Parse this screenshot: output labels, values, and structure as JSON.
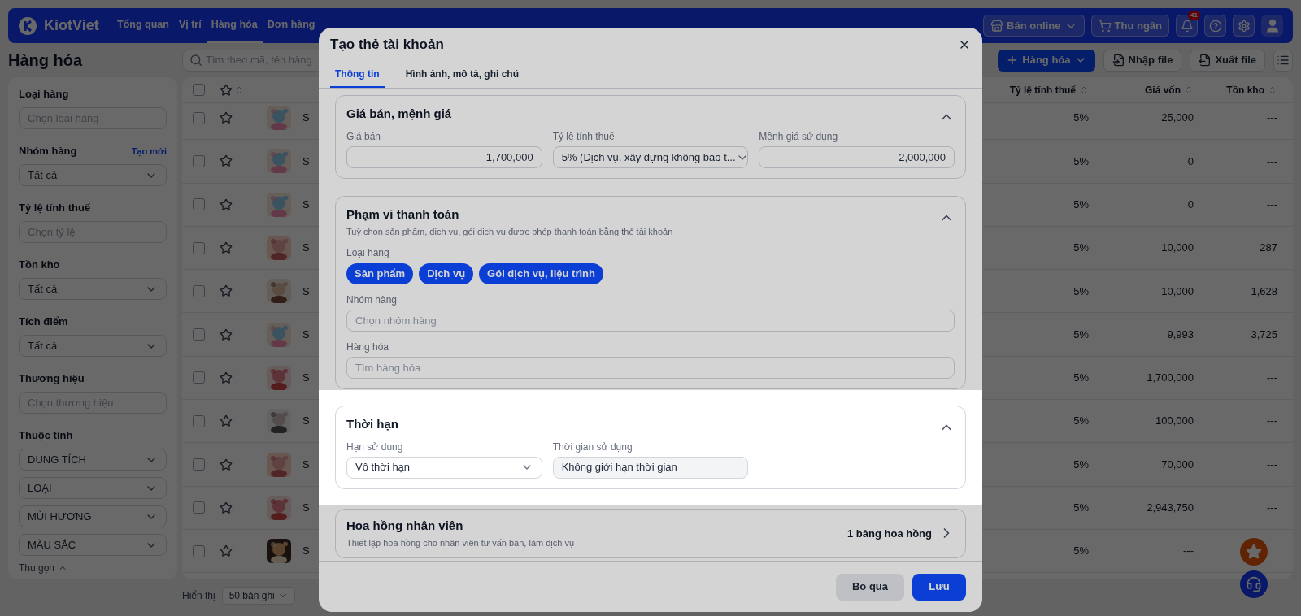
{
  "nav": {
    "logo": "KiotViet",
    "items": [
      {
        "label": "Tổng quan",
        "selected": false
      },
      {
        "label": "Vị trí",
        "selected": false
      },
      {
        "label": "Hàng hóa",
        "selected": true
      },
      {
        "label": "Đơn hàng",
        "selected": false
      }
    ],
    "online": "Bán online",
    "cashier": "Thu ngân",
    "notifications": "41"
  },
  "page": {
    "title": "Hàng hóa",
    "search_placeholder": "Tìm theo mã, tên hàng",
    "buttons": [
      {
        "label": "Hàng hóa",
        "kind": "create"
      },
      {
        "label": "Nhập file",
        "kind": "import"
      },
      {
        "label": "Xuất file",
        "kind": "export"
      }
    ]
  },
  "sidebar": {
    "filters": [
      {
        "label": "Loại hàng",
        "kind": "input",
        "placeholder": "Chọn loại hàng"
      },
      {
        "label": "Nhóm hàng",
        "kind": "select",
        "value": "Tất cả",
        "link": "Tạo mới"
      },
      {
        "label": "Tỷ lệ tính thuế",
        "kind": "input",
        "placeholder": "Chọn tỷ lệ"
      },
      {
        "label": "Tồn kho",
        "kind": "select",
        "value": "Tất cả"
      },
      {
        "label": "Tích điểm",
        "kind": "select",
        "value": "Tất cả"
      },
      {
        "label": "Thương hiệu",
        "kind": "input",
        "placeholder": "Chọn thương hiệu"
      },
      {
        "label": "Thuộc tính",
        "kind": "selects",
        "values": [
          "DUNG TÍCH",
          "LOẠI",
          "MÙI HƯƠNG",
          "MÀU SẮC"
        ]
      }
    ],
    "collapse": "Thu gọn"
  },
  "table": {
    "header_checked": false,
    "columns": [
      "Tỷ lệ tính thuế",
      "Giá vốn",
      "Tồn kho"
    ],
    "rows": [
      {
        "checked": false,
        "favorite": false,
        "name": "S",
        "tax": "5%",
        "cost": "25,000",
        "stock": "---"
      },
      {
        "checked": false,
        "favorite": false,
        "name": "S",
        "tax": "5%",
        "cost": "0",
        "stock": "---"
      },
      {
        "checked": false,
        "favorite": false,
        "name": "S",
        "tax": "5%",
        "cost": "0",
        "stock": "---"
      },
      {
        "checked": false,
        "favorite": false,
        "name": "S",
        "tax": "5%",
        "cost": "10,000",
        "stock": "287"
      },
      {
        "checked": false,
        "favorite": false,
        "name": "S",
        "tax": "5%",
        "cost": "10,000",
        "stock": "1,628"
      },
      {
        "checked": false,
        "favorite": false,
        "name": "S",
        "tax": "5%",
        "cost": "9,993",
        "stock": "3,725"
      },
      {
        "checked": false,
        "favorite": false,
        "name": "S",
        "tax": "5%",
        "cost": "1,700,000",
        "stock": "---"
      },
      {
        "checked": false,
        "favorite": false,
        "name": "S",
        "tax": "5%",
        "cost": "100,000",
        "stock": "---"
      },
      {
        "checked": false,
        "favorite": false,
        "name": "S",
        "tax": "5%",
        "cost": "70,000",
        "stock": "---"
      },
      {
        "checked": false,
        "favorite": false,
        "name": "S",
        "tax": "5%",
        "cost": "2,943,750",
        "stock": "---"
      },
      {
        "checked": false,
        "favorite": false,
        "name": "S",
        "tax": "5%",
        "cost": "---"
      }
    ],
    "footer_label": "Hiển thị",
    "page_size": "50 bản ghi"
  },
  "modal": {
    "title": "Tạo thẻ tài khoản",
    "tabs": [
      {
        "label": "Thông tin",
        "selected": true
      },
      {
        "label": "Hình ảnh, mô tả, ghi chú",
        "selected": false
      }
    ],
    "sections": [
      {
        "kind": "fields",
        "title": "Giá bán, mệnh giá",
        "expanded": true,
        "highlighted": false,
        "fields": [
          {
            "label": "Giá bán",
            "kind": "number",
            "value": "1,700,000"
          },
          {
            "label": "Tỷ lệ tính thuế",
            "kind": "select",
            "value": "5% (Dịch vụ, xây dựng không bao t..."
          },
          {
            "label": "Mệnh giá sử dụng",
            "kind": "number",
            "value": "2,000,000"
          }
        ]
      },
      {
        "kind": "scope",
        "title": "Phạm vi thanh toán",
        "subtitle": "Tuỳ chọn sản phẩm, dịch vụ, gói dịch vụ được phép thanh toán bằng thẻ tài khoản",
        "expanded": true,
        "highlighted": false,
        "chips_label": "Loại hàng",
        "chips": [
          {
            "label": "Sản phẩm",
            "selected": true
          },
          {
            "label": "Dịch vụ",
            "selected": true
          },
          {
            "label": "Gói dịch vụ, liệu trình",
            "selected": true
          }
        ],
        "fields": [
          {
            "label": "Nhóm hàng",
            "placeholder": "Chọn nhóm hàng"
          },
          {
            "label": "Hàng hóa",
            "placeholder": "Tìm hàng hóa"
          }
        ]
      },
      {
        "kind": "fields",
        "title": "Thời hạn",
        "expanded": true,
        "highlighted": true,
        "fields": [
          {
            "label": "Hạn sử dụng",
            "kind": "select",
            "value": "Vô thời hạn"
          },
          {
            "label": "Thời gian sử dụng",
            "kind": "readonly",
            "value": "Không giới hạn thời gian"
          }
        ]
      },
      {
        "kind": "link",
        "title": "Hoa hồng nhân viên",
        "subtitle": "Thiết lập hoa hồng cho nhân viên tư vấn bán, làm dịch vụ",
        "summary": "1 bảng hoa hồng",
        "highlighted": false
      }
    ],
    "buttons": [
      {
        "label": "Bỏ qua",
        "kind": "secondary"
      },
      {
        "label": "Lưu",
        "kind": "primary"
      }
    ]
  }
}
